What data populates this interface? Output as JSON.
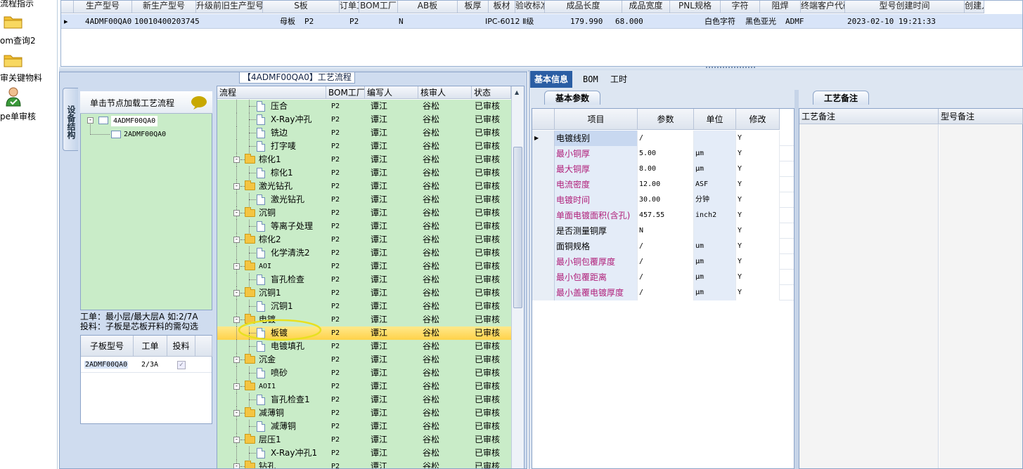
{
  "left_nav": {
    "items": [
      {
        "label": "流程指示",
        "icon": "folder-icon"
      },
      {
        "label": "om查询2",
        "icon": "folder-icon"
      },
      {
        "label": "审关键物料",
        "icon": "folder-icon"
      },
      {
        "label": "pe单审核",
        "icon": "user-check-icon"
      }
    ]
  },
  "top_grid": {
    "columns": [
      "生产型号",
      "新生产型号",
      "升级前旧生产型号",
      "S板",
      "订单工厂",
      "BOM工厂",
      "AB板",
      "板厚",
      "板材",
      "验收标准",
      "成品长度",
      "成品宽度",
      "PNL规格",
      "字符",
      "阻焊",
      "终端客户代码",
      "型号创建时间",
      "创建人"
    ],
    "row": {
      "marker": "▸",
      "cells": [
        "4ADMF00QA0",
        "10010400203745",
        "",
        "母板",
        "P2",
        "P2",
        "N",
        "",
        "",
        "IPC-6012 Ⅱ级",
        "179.990",
        "68.000",
        "",
        "白色字符",
        "黑色亚光",
        "ADMF",
        "2023-02-10 19:21:33",
        ""
      ]
    }
  },
  "process_panel": {
    "title": "【4ADMF00QA0】工艺流程",
    "side_tab": "设备结构",
    "tree_hint": "单击节点加载工艺流程",
    "tree_nodes": [
      "4ADMF00QA0",
      "2ADMF00QA0"
    ],
    "notes_line1": "工单：最小层/最大层A 如:2/7A",
    "notes_line2": "投料：子板是芯板开料的需勾选",
    "sub_grid": {
      "columns": [
        "子板型号",
        "工单",
        "投料"
      ],
      "rows": [
        {
          "model": "2ADMF00QA0",
          "order": "2/3A",
          "feed_checked": true
        }
      ]
    }
  },
  "flow_grid": {
    "columns": [
      "流程",
      "BOM工厂",
      "编写人",
      "核审人",
      "状态"
    ],
    "rows": [
      {
        "type": "child",
        "name": "压合",
        "bom": "P2",
        "writer": "谭江",
        "reviewer": "谷松",
        "status": "已审核"
      },
      {
        "type": "child",
        "name": "X-Ray冲孔",
        "bom": "P2",
        "writer": "谭江",
        "reviewer": "谷松",
        "status": "已审核"
      },
      {
        "type": "child",
        "name": "铣边",
        "bom": "P2",
        "writer": "谭江",
        "reviewer": "谷松",
        "status": "已审核"
      },
      {
        "type": "child",
        "name": "打字唛",
        "bom": "P2",
        "writer": "谭江",
        "reviewer": "谷松",
        "status": "已审核"
      },
      {
        "type": "group",
        "name": "棕化1",
        "bom": "P2",
        "writer": "谭江",
        "reviewer": "谷松",
        "status": "已审核"
      },
      {
        "type": "child",
        "name": "棕化1",
        "bom": "P2",
        "writer": "谭江",
        "reviewer": "谷松",
        "status": "已审核"
      },
      {
        "type": "group",
        "name": "激光钻孔",
        "bom": "P2",
        "writer": "谭江",
        "reviewer": "谷松",
        "status": "已审核"
      },
      {
        "type": "child",
        "name": "激光钻孔",
        "bom": "P2",
        "writer": "谭江",
        "reviewer": "谷松",
        "status": "已审核"
      },
      {
        "type": "group",
        "name": "沉铜",
        "bom": "P2",
        "writer": "谭江",
        "reviewer": "谷松",
        "status": "已审核"
      },
      {
        "type": "child",
        "name": "等离子处理",
        "bom": "P2",
        "writer": "谭江",
        "reviewer": "谷松",
        "status": "已审核"
      },
      {
        "type": "group",
        "name": "棕化2",
        "bom": "P2",
        "writer": "谭江",
        "reviewer": "谷松",
        "status": "已审核"
      },
      {
        "type": "child",
        "name": "化学清洗2",
        "bom": "P2",
        "writer": "谭江",
        "reviewer": "谷松",
        "status": "已审核"
      },
      {
        "type": "group",
        "name": "AOI",
        "bom": "P2",
        "writer": "谭江",
        "reviewer": "谷松",
        "status": "已审核"
      },
      {
        "type": "child",
        "name": "盲孔检查",
        "bom": "P2",
        "writer": "谭江",
        "reviewer": "谷松",
        "status": "已审核"
      },
      {
        "type": "group",
        "name": "沉铜1",
        "bom": "P2",
        "writer": "谭江",
        "reviewer": "谷松",
        "status": "已审核"
      },
      {
        "type": "child",
        "name": "沉铜1",
        "bom": "P2",
        "writer": "谭江",
        "reviewer": "谷松",
        "status": "已审核"
      },
      {
        "type": "group",
        "name": "电镀",
        "bom": "P2",
        "writer": "谭江",
        "reviewer": "谷松",
        "status": "已审核"
      },
      {
        "type": "child",
        "name": "板镀",
        "bom": "P2",
        "writer": "谭江",
        "reviewer": "谷松",
        "status": "已审核",
        "selected": true
      },
      {
        "type": "child",
        "name": "电镀填孔",
        "bom": "P2",
        "writer": "谭江",
        "reviewer": "谷松",
        "status": "已审核"
      },
      {
        "type": "group",
        "name": "沉金",
        "bom": "P2",
        "writer": "谭江",
        "reviewer": "谷松",
        "status": "已审核"
      },
      {
        "type": "child",
        "name": "喷砂",
        "bom": "P2",
        "writer": "谭江",
        "reviewer": "谷松",
        "status": "已审核"
      },
      {
        "type": "group",
        "name": "AOI1",
        "bom": "P2",
        "writer": "谭江",
        "reviewer": "谷松",
        "status": "已审核"
      },
      {
        "type": "child",
        "name": "盲孔检查1",
        "bom": "P2",
        "writer": "谭江",
        "reviewer": "谷松",
        "status": "已审核"
      },
      {
        "type": "group",
        "name": "减薄铜",
        "bom": "P2",
        "writer": "谭江",
        "reviewer": "谷松",
        "status": "已审核"
      },
      {
        "type": "child",
        "name": "减薄铜",
        "bom": "P2",
        "writer": "谭江",
        "reviewer": "谷松",
        "status": "已审核"
      },
      {
        "type": "group",
        "name": "层压1",
        "bom": "P2",
        "writer": "谭江",
        "reviewer": "谷松",
        "status": "已审核"
      },
      {
        "type": "child",
        "name": "X-Ray冲孔1",
        "bom": "P2",
        "writer": "谭江",
        "reviewer": "谷松",
        "status": "已审核"
      },
      {
        "type": "group",
        "name": "钻孔",
        "bom": "P2",
        "writer": "谭江",
        "reviewer": "谷松",
        "status": "已审核"
      }
    ]
  },
  "right_panel": {
    "tabs": [
      "基本信息",
      "BOM",
      "工时"
    ],
    "basic_params_title": "基本参数",
    "columns": [
      "项目",
      "参数",
      "单位",
      "修改"
    ],
    "rows": [
      {
        "item": "电镀线别",
        "param": "/",
        "unit": "",
        "edit": "Y",
        "pink": false,
        "current": true
      },
      {
        "item": "最小铜厚",
        "param": "5.00",
        "unit": "μm",
        "edit": "Y",
        "pink": true
      },
      {
        "item": "最大铜厚",
        "param": "8.00",
        "unit": "μm",
        "edit": "Y",
        "pink": true
      },
      {
        "item": "电流密度",
        "param": "12.00",
        "unit": "ASF",
        "edit": "Y",
        "pink": true
      },
      {
        "item": "电镀时间",
        "param": "30.00",
        "unit": "分钟",
        "edit": "Y",
        "pink": true
      },
      {
        "item": "单面电镀面积(含孔)",
        "param": "457.55",
        "unit": "inch2",
        "edit": "Y",
        "pink": true
      },
      {
        "item": "是否测量铜厚",
        "param": "N",
        "unit": "",
        "edit": "Y",
        "pink": false
      },
      {
        "item": "面铜规格",
        "param": "/",
        "unit": "um",
        "edit": "Y",
        "pink": false
      },
      {
        "item": "最小铜包覆厚度",
        "param": "/",
        "unit": "μm",
        "edit": "Y",
        "pink": true
      },
      {
        "item": "最小包覆距离",
        "param": "/",
        "unit": "μm",
        "edit": "Y",
        "pink": true
      },
      {
        "item": "最小盖覆电镀厚度",
        "param": "/",
        "unit": "μm",
        "edit": "Y",
        "pink": true
      }
    ],
    "remark_tab": "工艺备注",
    "remark_columns": [
      "工艺备注",
      "型号备注"
    ]
  },
  "colors": {
    "highlight_circle": "#e8e020",
    "selected_row": "#ffd24a",
    "tree_bg": "#c9ecc8",
    "pink_text": "#b0207a",
    "tab_active": "#2b5ea4"
  }
}
